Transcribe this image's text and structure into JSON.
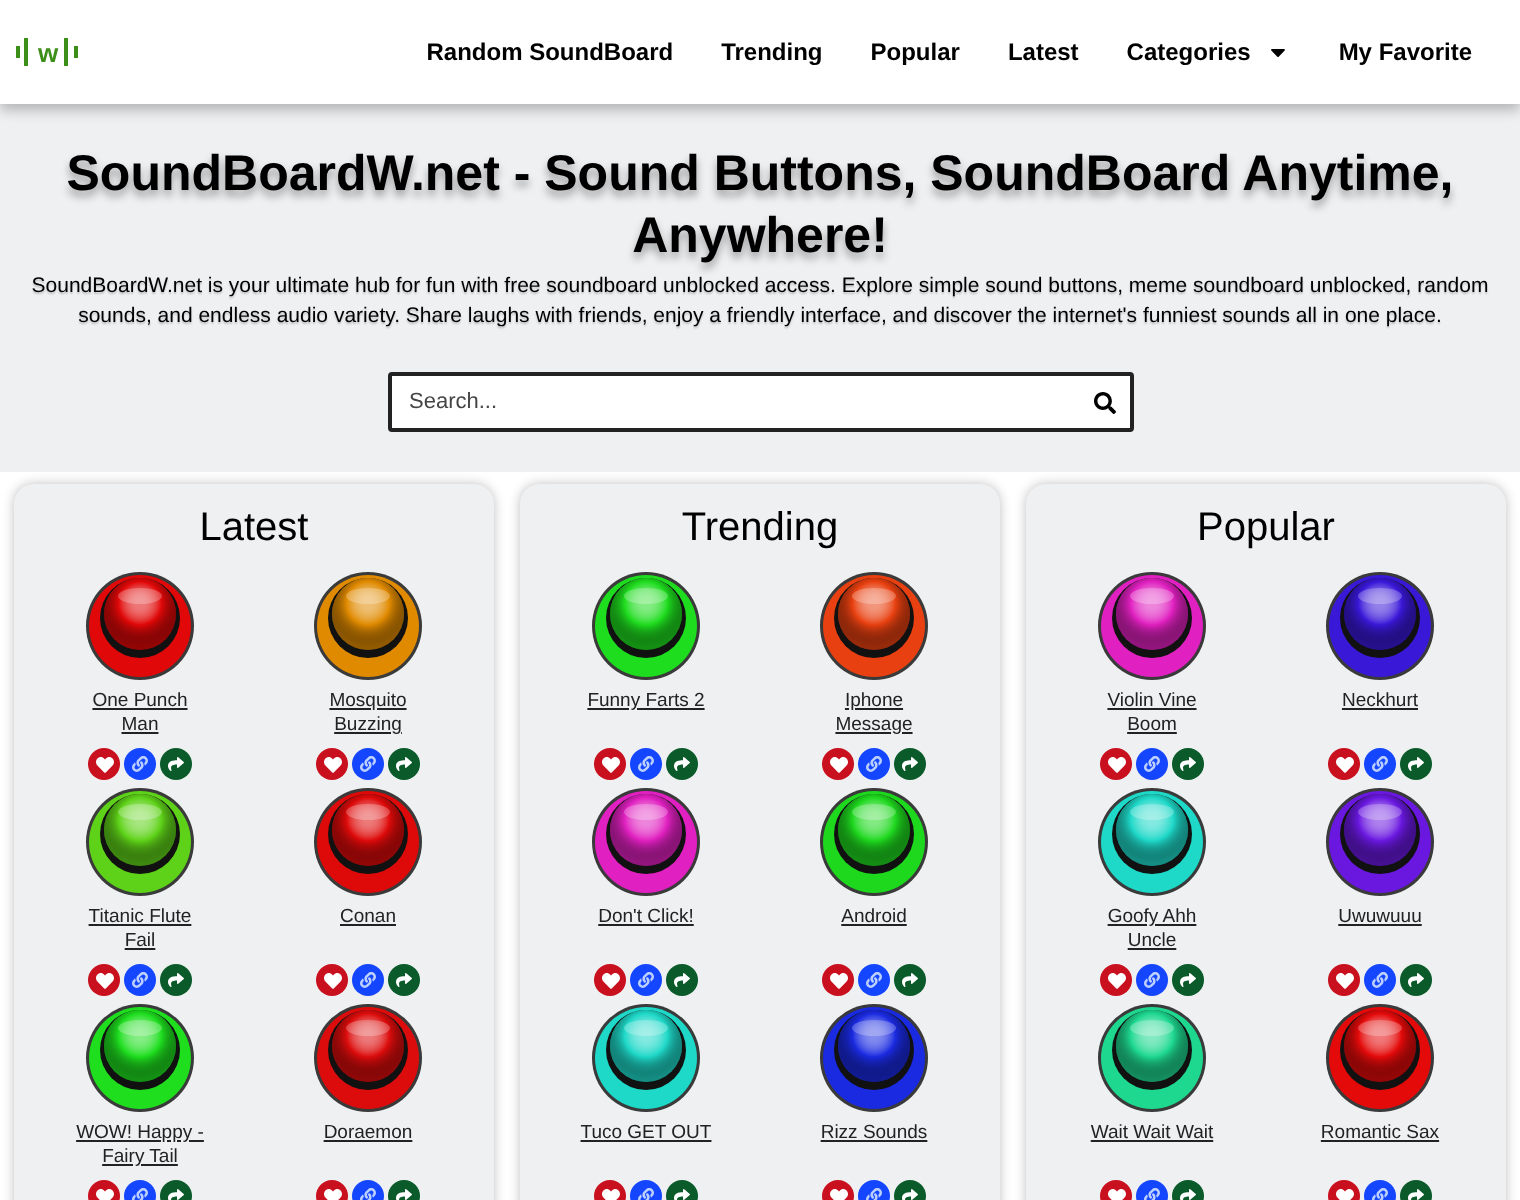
{
  "logo": {
    "text": "w"
  },
  "nav": [
    {
      "label": "Random SoundBoard",
      "kind": "link"
    },
    {
      "label": "Trending",
      "kind": "link"
    },
    {
      "label": "Popular",
      "kind": "link"
    },
    {
      "label": "Latest",
      "kind": "link"
    },
    {
      "label": "Categories",
      "kind": "dropdown"
    },
    {
      "label": "My Favorite",
      "kind": "link"
    }
  ],
  "hero": {
    "title": "SoundBoardW.net - Sound Buttons, SoundBoard Anytime, Anywhere!",
    "description": "SoundBoardW.net is your ultimate hub for fun with free soundboard unblocked access. Explore simple sound buttons, meme soundboard unblocked, random sounds, and endless audio variety. Share laughs with friends, enjoy a friendly interface, and discover the internet's funniest sounds all in one place.",
    "search": {
      "placeholder": "Search..."
    }
  },
  "sections": [
    {
      "title": "Latest",
      "sounds": [
        {
          "name": "One Punch Man",
          "color": "#e00808"
        },
        {
          "name": "Mosquito Buzzing",
          "color": "#e08a00"
        },
        {
          "name": "Titanic Flute Fail",
          "color": "#5ed218"
        },
        {
          "name": "Conan",
          "color": "#de0a0a"
        },
        {
          "name": "WOW! Happy - Fairy Tail",
          "color": "#1ede1e"
        },
        {
          "name": "Doraemon",
          "color": "#dc0c0c"
        }
      ]
    },
    {
      "title": "Trending",
      "sounds": [
        {
          "name": "Funny Farts 2",
          "color": "#1edc1e"
        },
        {
          "name": "Iphone Message",
          "color": "#e84010"
        },
        {
          "name": "Don't Click!",
          "color": "#e020c0"
        },
        {
          "name": "Android",
          "color": "#1ed81e"
        },
        {
          "name": "Tuco GET OUT",
          "color": "#1ed8c8"
        },
        {
          "name": "Rizz Sounds",
          "color": "#1a2ae0"
        }
      ]
    },
    {
      "title": "Popular",
      "sounds": [
        {
          "name": "Violin Vine Boom",
          "color": "#e020c0"
        },
        {
          "name": "Neckhurt",
          "color": "#3a18d8"
        },
        {
          "name": "Goofy Ahh Uncle",
          "color": "#1ed8c8"
        },
        {
          "name": "Uwuwuuu",
          "color": "#6a18e0"
        },
        {
          "name": "Wait Wait Wait",
          "color": "#1ed890"
        },
        {
          "name": "Romantic Sax",
          "color": "#e40a0a"
        }
      ]
    }
  ]
}
